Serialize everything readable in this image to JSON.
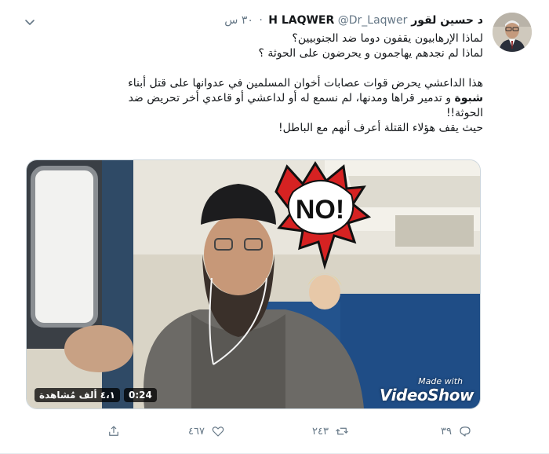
{
  "tweet": {
    "display_name": "د حسين لقور H LAQWER",
    "handle": "@Dr_Laqwer",
    "separator": "·",
    "time": "٣٠ س",
    "lines": [
      "لماذا الإرهابيون يقفون دوما ضد الجنوبيين؟",
      "لماذا لم نجدهم يهاجمون و يحرضون على الحوثة ؟",
      "",
      "هذا الداعشي يحرض قوات عصابات أخوان المسلمين في عدوانها على قتل أبناء"
    ],
    "line5_bold": "شبوة",
    "line5_rest": " و تدمير  قراها  ومدنها، لم نسمع له أو لداعشي أو قاعدي أخر تحريض ضد",
    "line6": "الحوثة!!",
    "line7": "حيث يقف هؤلاء القتلة أعرف أنهم  مع الباطل!"
  },
  "media": {
    "duration": "0:24",
    "views": "٤،١ ألف مُشاهدة",
    "sticker_text": "NO!",
    "watermark_small": "Made with",
    "watermark_large": "VideoShow"
  },
  "actions": {
    "reply_count": "٣٩",
    "retweet_count": "٢٤٣",
    "like_count": "٤٦٧",
    "share_count": ""
  },
  "icons": {
    "reply": "reply-icon",
    "retweet": "retweet-icon",
    "like": "heart-icon",
    "share": "share-icon",
    "menu": "chevron-down-icon"
  }
}
